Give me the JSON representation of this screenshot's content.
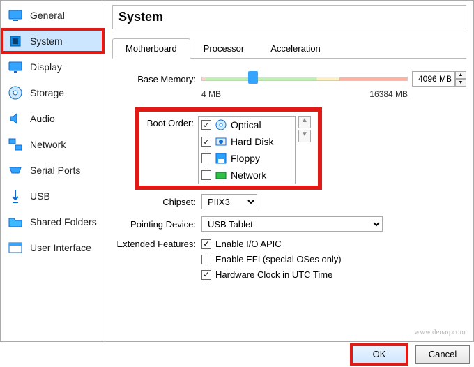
{
  "page_title": "System",
  "sidebar": {
    "items": [
      {
        "label": "General"
      },
      {
        "label": "System"
      },
      {
        "label": "Display"
      },
      {
        "label": "Storage"
      },
      {
        "label": "Audio"
      },
      {
        "label": "Network"
      },
      {
        "label": "Serial Ports"
      },
      {
        "label": "USB"
      },
      {
        "label": "Shared Folders"
      },
      {
        "label": "User Interface"
      }
    ]
  },
  "tabs": {
    "items": [
      {
        "label": "Motherboard"
      },
      {
        "label": "Processor"
      },
      {
        "label": "Acceleration"
      }
    ]
  },
  "form": {
    "base_memory_label": "Base Memory:",
    "base_memory_value": "4096 MB",
    "base_memory_min": "4 MB",
    "base_memory_max": "16384 MB",
    "boot_order_label": "Boot Order:",
    "boot_items": [
      {
        "label": "Optical",
        "checked": true
      },
      {
        "label": "Hard Disk",
        "checked": true
      },
      {
        "label": "Floppy",
        "checked": false
      },
      {
        "label": "Network",
        "checked": false
      }
    ],
    "chipset_label": "Chipset:",
    "chipset_value": "PIIX3",
    "pointing_label": "Pointing Device:",
    "pointing_value": "USB Tablet",
    "extended_label": "Extended Features:",
    "feat_ioapic": "Enable I/O APIC",
    "feat_efi": "Enable EFI (special OSes only)",
    "feat_utc": "Hardware Clock in UTC Time"
  },
  "footer": {
    "ok": "OK",
    "cancel": "Cancel"
  },
  "watermark": "www.deuaq.com"
}
